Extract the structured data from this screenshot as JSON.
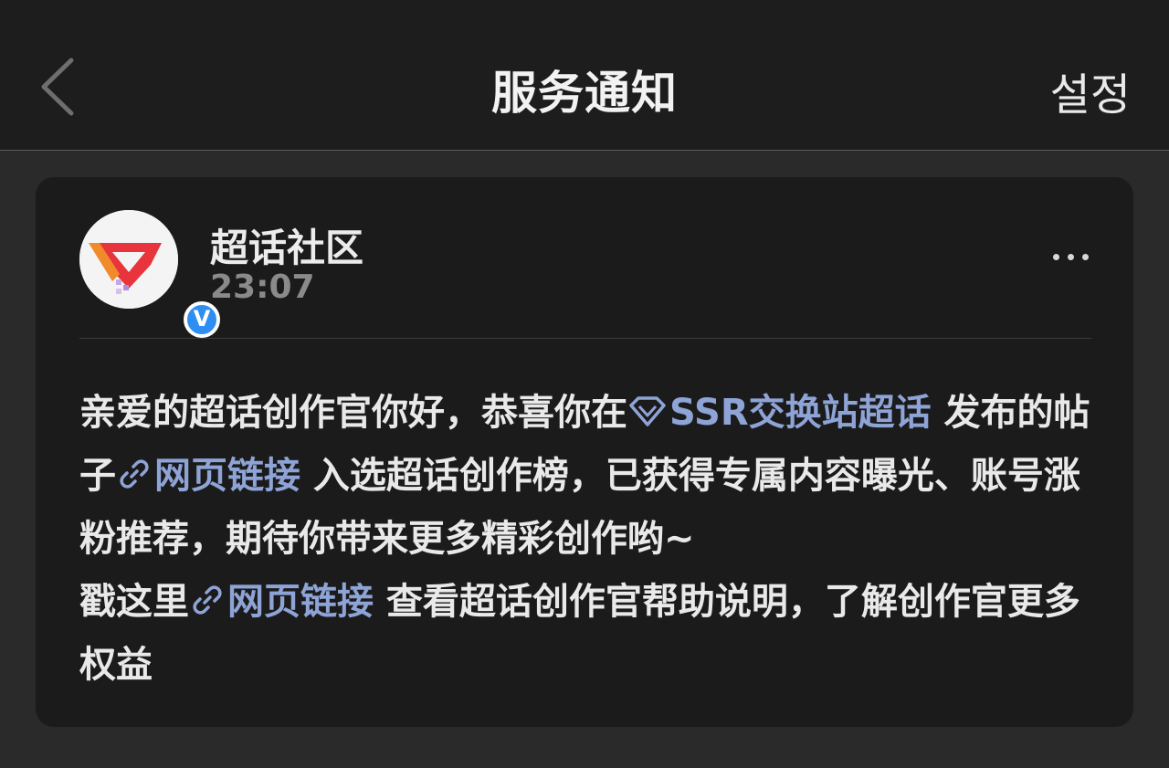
{
  "header": {
    "title": "服务通知",
    "settings_label": "설정"
  },
  "notification": {
    "sender_name": "超话社区",
    "time": "23:07",
    "verified_mark": "V",
    "message": {
      "line1_text": "亲爱的超话创作官你好，恭喜你在",
      "topic_link": "SSR交换站超话",
      "text_2": " 发布的帖子",
      "link_1": "网页链接",
      "text_3": " 入选超话创作榜，已获得专属内容曝光、账号涨粉推荐，期待你带来更多精彩创作哟~",
      "text_4": "戳这里",
      "link_2": "网页链接",
      "text_5": " 查看超话创作官帮助说明，了解创作官更多权益"
    }
  },
  "colors": {
    "link": "#8ea3d6",
    "verified_badge": "#2f8ef2",
    "logo_red": "#e8343c"
  },
  "icons": {
    "back": "chevron-left-icon",
    "more": "more-dots-icon",
    "topic": "diamond-icon",
    "link": "link-chain-icon"
  }
}
